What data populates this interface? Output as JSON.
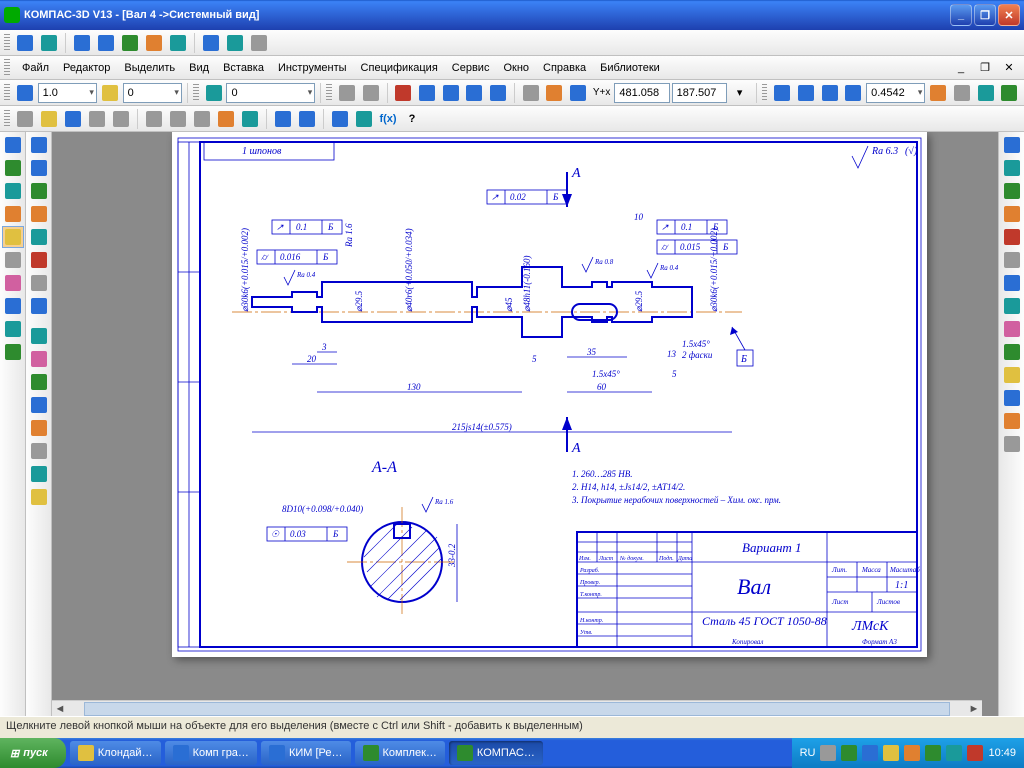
{
  "window": {
    "title": "КОМПАС-3D V13 - [Вал 4 ->Системный вид]"
  },
  "menu": [
    "Файл",
    "Редактор",
    "Выделить",
    "Вид",
    "Вставка",
    "Инструменты",
    "Спецификация",
    "Сервис",
    "Окно",
    "Справка",
    "Библиотеки"
  ],
  "props": {
    "scale_combo": "1.0",
    "layer_combo": "0",
    "style_combo": "0",
    "x_label": "Y+x",
    "coord_x": "481.058",
    "coord_y": "187.507",
    "zoom": "0.4542"
  },
  "status": "Щелкните левой кнопкой мыши на объекте для его выделения (вместе с Ctrl или Shift - добавить к выделенным)",
  "taskbar": {
    "start": "пуск",
    "tasks": [
      "Клондай…",
      "Комп гра…",
      "КИМ [Ре…",
      "Комплек…",
      "КОМПАС…"
    ],
    "lang": "RU",
    "clock": "10:49"
  },
  "drawing": {
    "frame_note_tl": "1 шпонов",
    "section_label_top": "А",
    "section_label_bot": "А",
    "section_title": "А-А",
    "surf_general": "Ra 6.3",
    "surf_general_paren": "(√)",
    "gdt": {
      "g1": [
        "↗",
        "0.1",
        "Б"
      ],
      "g2": [
        "⌭",
        "0.016",
        "Б"
      ],
      "g3": [
        "↗",
        "0.02",
        "Б"
      ],
      "g4": [
        "↗",
        "0.1",
        "Б"
      ],
      "g5": [
        "⌭",
        "0.015",
        "Б"
      ],
      "g6": [
        "☉",
        "0.03",
        "Б"
      ]
    },
    "surf": {
      "r04a": "Ra 0.4",
      "r04b": "Ra 0.4",
      "r08": "Ra 0.8",
      "r16a": "Ra 1.6",
      "r16b": "Ra 1.6"
    },
    "dims": {
      "d30_1": "⌀30k6(+0.015/+0.002)",
      "d30_2": "⌀30k6(+0.015/+0.002)",
      "d29_l": "⌀29.5",
      "d29_r": "⌀29.5",
      "d40": "⌀40r6(+0.050/+0.034)",
      "d45": "⌀45",
      "d48": "⌀48h11(-0.160)",
      "L3": "3",
      "L20": "20",
      "L130": "130",
      "L10": "10",
      "L13": "13",
      "L35": "35",
      "L5a": "5",
      "L5b": "5",
      "L60": "60",
      "Ltotal": "215js14(±0.575)",
      "ch": "1.5x45°",
      "ch2": "1.5x45°",
      "chn": "2 фаски",
      "key_w": "8D10(+0.098/+0.040)",
      "sec_d": "33-0.2"
    },
    "datum": "Б",
    "notes": [
      "1. 260…285 HB.",
      "2. H14, h14, ±Js14/2, ±AT14/2.",
      "3. Покрытие нерабочих поверхностей – Хим. окс. прм."
    ],
    "titleblock": {
      "variant": "Вариант 1",
      "name": "Вал",
      "material": "Сталь 45 ГОСТ 1050-88",
      "org": "ЛМсК",
      "scale": "1:1",
      "sheets_lbl": "Листов",
      "sheet_lbl": "Лист",
      "mass_lbl": "Масса",
      "scale_lbl": "Масштаб",
      "lit_lbl": "Лит.",
      "rows": [
        "Изм.",
        "Лист",
        "№ докум.",
        "Подп.",
        "Дата"
      ],
      "left_rows": [
        "Разраб.",
        "Провер.",
        "Т.контр.",
        "",
        "Н.контр.",
        "Утв."
      ],
      "footer": "Копировал",
      "fmt": "Формат   A3"
    }
  }
}
